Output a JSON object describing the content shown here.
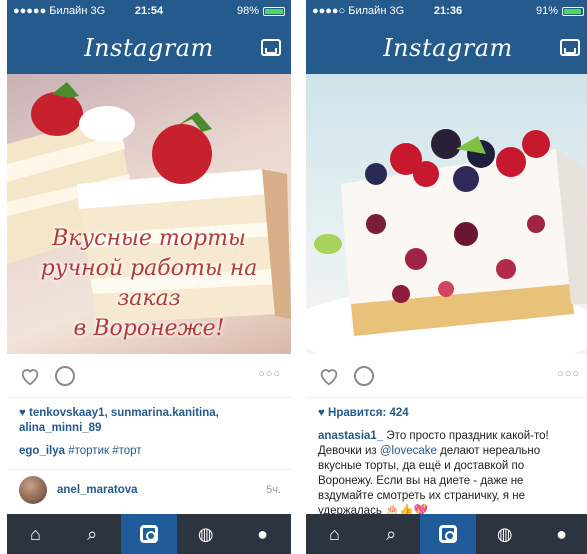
{
  "left": {
    "status": {
      "signal": "●●●●● Билайн 3G",
      "time": "21:54",
      "battery": "98%"
    },
    "header": {
      "logo": "Instagram"
    },
    "photo_text": [
      "Вкусные торты",
      "ручной работы на заказ",
      "в Воронеже!"
    ],
    "likes": {
      "users": "tenkovskaay1, sunmarina.kanitina, alina_minni_89"
    },
    "comment": {
      "user": "ego_ilya",
      "text": "#тортик #торт"
    },
    "commenter": {
      "name": "anel_maratova",
      "time": "5ч."
    }
  },
  "right": {
    "status": {
      "signal": "●●●●○ Билайн 3G",
      "time": "21:36",
      "battery": "91%"
    },
    "header": {
      "logo": "Instagram"
    },
    "likes": {
      "text": "Нравится: 424"
    },
    "caption": {
      "user": "anastasia1_",
      "text_a": " Это просто праздник какой-то! Девочки из ",
      "mention": "@lovecake",
      "text_b": " делают нереально вкусные торты, да ещё и доставкой по Воронежу. Если вы на диете - даже не вздумайте смотреть их страничку, я не удержалась 🎂👍💖"
    }
  },
  "icons": {
    "heart": "heart-icon",
    "comment": "comment-icon",
    "more": "more-icon",
    "home": "home-icon",
    "search": "search-icon",
    "camera": "camera-icon",
    "activity": "activity-icon",
    "profile": "profile-icon",
    "inbox": "inbox-icon"
  },
  "colors": {
    "brand": "#245a8c",
    "tabbar": "#2c3440",
    "active_tab": "#1f5c99"
  }
}
